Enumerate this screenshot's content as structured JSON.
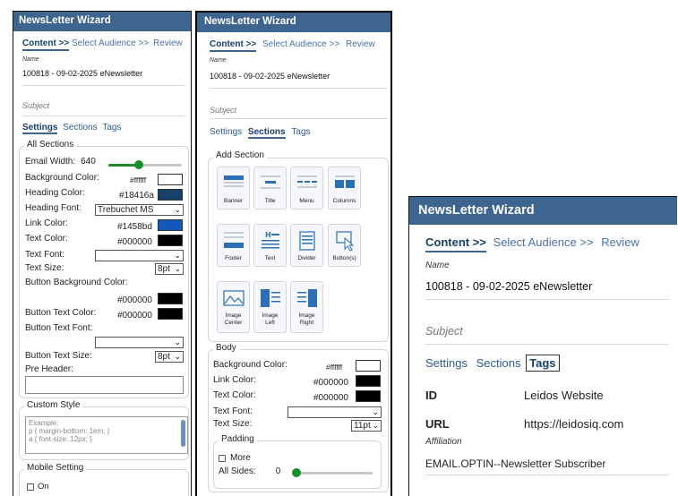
{
  "wizard_title": "NewsLetter Wizard",
  "nav": {
    "content": "Content >>",
    "audience": "Select Audience >>",
    "review": "Review"
  },
  "name_label": "Name",
  "name_value": "100818 - 09-02-2025 eNewsletter",
  "subject_label": "Subject",
  "tabs": {
    "settings": "Settings",
    "sections": "Sections",
    "tags": "Tags"
  },
  "settings": {
    "all_sections": "All Sections",
    "email_width_label": "Email Width:",
    "email_width_value": "640",
    "bg_color_label": "Background Color:",
    "bg_color_value": "#ffffff",
    "heading_color_label": "Heading Color:",
    "heading_color_value": "#18416a",
    "heading_font_label": "Heading Font:",
    "heading_font_value": "Trebuchet MS",
    "link_color_label": "Link Color:",
    "link_color_value": "#1458bd",
    "text_color_label": "Text Color:",
    "text_color_value": "#000000",
    "text_font_label": "Text Font:",
    "text_size_label": "Text Size:",
    "text_size_value": "8pt",
    "button_bg_label": "Button Background Color:",
    "button_bg_value": "#000000",
    "button_text_color_label": "Button Text Color:",
    "button_text_color_value": "#000000",
    "button_text_font_label": "Button Text Font:",
    "button_text_size_label": "Button Text Size:",
    "button_text_size_value": "8pt",
    "pre_header_label": "Pre Header:",
    "custom_style_label": "Custom Style",
    "custom_style_placeholder_1": "Example:",
    "custom_style_placeholder_2": "p { margin-bottom: 1em; }",
    "custom_style_placeholder_3": "a { font-size: 12px; }",
    "mobile_setting_label": "Mobile Setting",
    "mobile_on_label": "On"
  },
  "sections": {
    "add_section": "Add Section",
    "tiles": [
      "Banner",
      "Title",
      "Menu",
      "Columns",
      "Footer",
      "Text",
      "Divider",
      "Button(s)",
      "Image Center",
      "Image Left",
      "Image Right"
    ],
    "body_label": "Body",
    "bg_color_label": "Background Color:",
    "bg_color_value": "#ffffff",
    "link_color_label": "Link Color:",
    "link_color_value": "#000000",
    "text_color_label": "Text Color:",
    "text_color_value": "#000000",
    "text_font_label": "Text Font:",
    "text_size_label": "Text Size:",
    "text_size_value": "11pt",
    "padding_label": "Padding",
    "more_label": "More",
    "all_sides_label": "All Sides:",
    "all_sides_value": "0"
  },
  "tags": {
    "id_label": "ID",
    "id_value": "Leidos Website",
    "url_label": "URL",
    "url_value": "https://leidosiq.com",
    "affiliation_label": "Affiliation",
    "affiliation_value": "EMAIL.OPTIN--Newsletter Subscriber"
  },
  "colors": {
    "header_bg": "#3e6590",
    "heading_swatch": "#18416a",
    "link_swatch": "#1458bd",
    "slider_green": "#1a8a2a"
  },
  "email_width_slider_fraction": 0.42,
  "all_sides_slider_fraction": 0.0
}
